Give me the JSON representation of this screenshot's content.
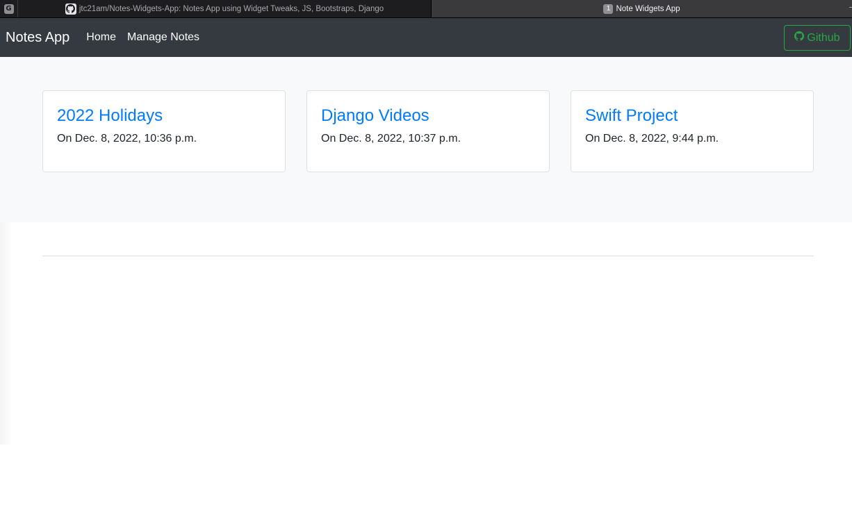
{
  "browser": {
    "g_icon": "G",
    "tabs": [
      {
        "title": "jtc21am/Notes-Widgets-App: Notes App using Widget Tweaks, JS, Bootstraps, Django",
        "icon": "github-icon"
      },
      {
        "title": "Note Widgets App",
        "badge": "1"
      }
    ]
  },
  "navbar": {
    "brand": "Notes App",
    "links": [
      "Home",
      "Manage Notes"
    ],
    "github_button": "Github"
  },
  "notes": [
    {
      "title": "2022 Holidays",
      "date": "On Dec. 8, 2022, 10:36 p.m."
    },
    {
      "title": "Django Videos",
      "date": "On Dec. 8, 2022, 10:37 p.m."
    },
    {
      "title": "Swift Project",
      "date": "On Dec. 8, 2022, 9:44 p.m."
    }
  ],
  "colors": {
    "navbar_bg": "#343a40",
    "link_blue": "#007bff",
    "success_green": "#28a745",
    "light_bg": "#f8f9fa"
  }
}
